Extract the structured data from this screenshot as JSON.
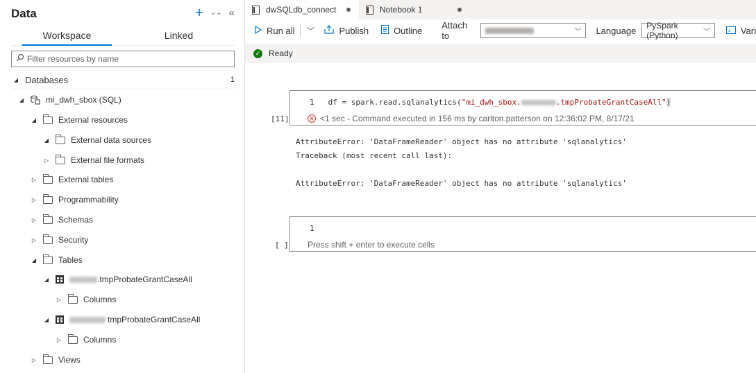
{
  "data_panel": {
    "title": "Data",
    "actions": {
      "add": "+",
      "expand": "⌄⌄",
      "collapse": "«"
    },
    "tabs": [
      {
        "label": "Workspace",
        "active": true
      },
      {
        "label": "Linked",
        "active": false
      }
    ],
    "filter_placeholder": "Filter resources by name",
    "tree": {
      "databases_label": "Databases",
      "databases_count": "1",
      "db_name": "mi_dwh_sbox (SQL)",
      "external_resources": "External resources",
      "external_data_sources": "External data sources",
      "external_file_formats": "External file formats",
      "external_tables": "External tables",
      "programmability": "Programmability",
      "schemas": "Schemas",
      "security": "Security",
      "tables": "Tables",
      "table1_suffix": ".tmpProbateGrantCaseAll",
      "table1_columns": "Columns",
      "table2_suffix": "tmpProbateGrantCaseAll",
      "table2_columns": "Columns",
      "views": "Views"
    }
  },
  "doc_tabs": [
    {
      "label": "dwSQLdb_connect",
      "active": true
    },
    {
      "label": "Notebook 1",
      "active": false
    }
  ],
  "toolbar": {
    "run_all": "Run all",
    "publish": "Publish",
    "outline": "Outline",
    "attach_to_label": "Attach to",
    "language_label": "Language",
    "language_value": "PySpark (Python)",
    "variables": "Vari"
  },
  "status": {
    "text": "Ready"
  },
  "cell1": {
    "exec_count": "[11]",
    "line_number": "1",
    "code_prefix": "df = spark.read.sqlanalytics(",
    "code_string_start": "\"mi_dwh_sbox.",
    "code_string_end": ".tmpProbateGrantCaseAll\"",
    "code_suffix": ")",
    "status_text": "<1 sec - Command executed in 156 ms by carlton.patterson on 12:36:02 PM, 8/17/21"
  },
  "output_lines": [
    "AttributeError: 'DataFrameReader' object has no attribute 'sqlanalytics'",
    "Traceback (most recent call last):",
    "",
    "AttributeError: 'DataFrameReader' object has no attribute 'sqlanalytics'"
  ],
  "cell2": {
    "exec_count": "[ ]",
    "line_number": "1",
    "placeholder": "Press shift + enter to execute cells"
  },
  "colors": {
    "accent": "#0078d4",
    "success": "#107c10",
    "error": "#d13438"
  }
}
